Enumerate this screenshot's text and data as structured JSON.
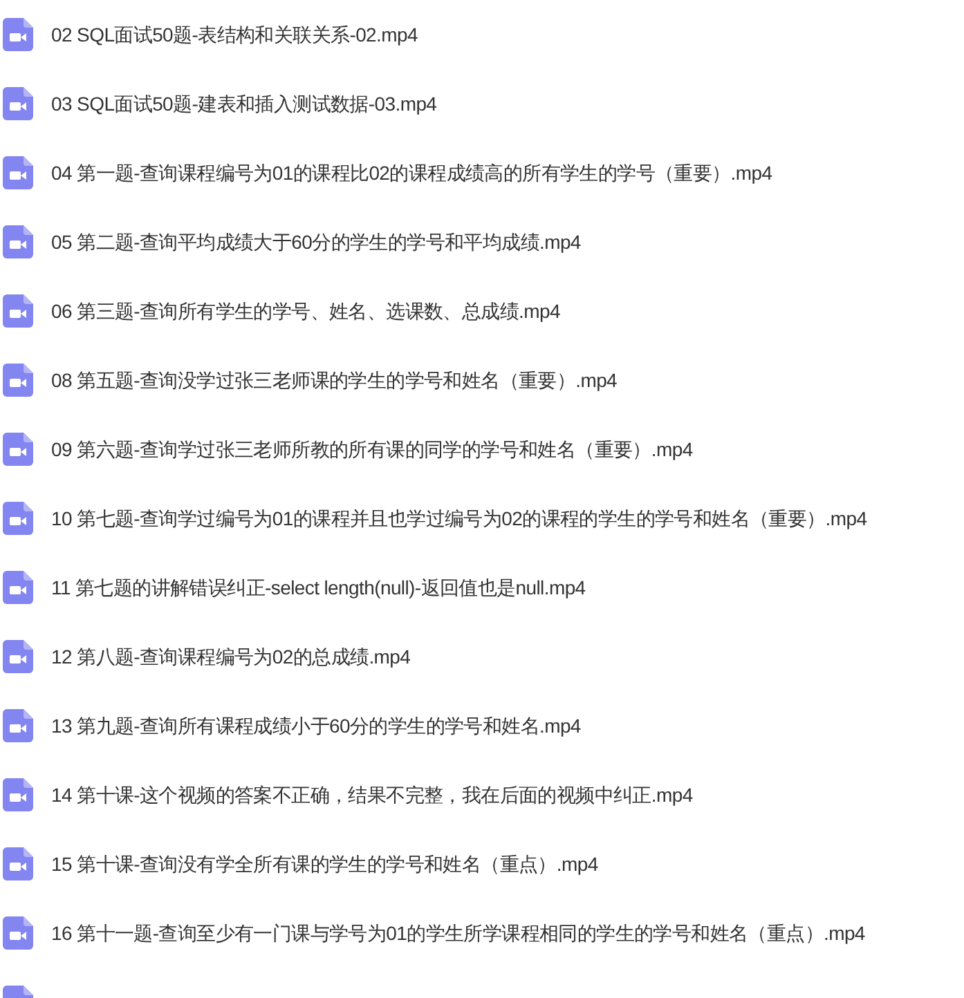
{
  "files": [
    {
      "name": "02 SQL面试50题-表结构和关联关系-02.mp4"
    },
    {
      "name": "03 SQL面试50题-建表和插入测试数据-03.mp4"
    },
    {
      "name": "04 第一题-查询课程编号为01的课程比02的课程成绩高的所有学生的学号（重要）.mp4"
    },
    {
      "name": "05 第二题-查询平均成绩大于60分的学生的学号和平均成绩.mp4"
    },
    {
      "name": "06 第三题-查询所有学生的学号、姓名、选课数、总成绩.mp4"
    },
    {
      "name": "08 第五题-查询没学过张三老师课的学生的学号和姓名（重要）.mp4"
    },
    {
      "name": "09 第六题-查询学过张三老师所教的所有课的同学的学号和姓名（重要）.mp4"
    },
    {
      "name": "10 第七题-查询学过编号为01的课程并且也学过编号为02的课程的学生的学号和姓名（重要）.mp4"
    },
    {
      "name": "11 第七题的讲解错误纠正-select length(null)-返回值也是null.mp4"
    },
    {
      "name": "12 第八题-查询课程编号为02的总成绩.mp4"
    },
    {
      "name": "13 第九题-查询所有课程成绩小于60分的学生的学号和姓名.mp4"
    },
    {
      "name": "14 第十课-这个视频的答案不正确，结果不完整，我在后面的视频中纠正.mp4"
    },
    {
      "name": "15 第十课-查询没有学全所有课的学生的学号和姓名（重点）.mp4"
    },
    {
      "name": "16 第十一题-查询至少有一门课与学号为01的学生所学课程相同的学生的学号和姓名（重点）.mp4"
    }
  ]
}
